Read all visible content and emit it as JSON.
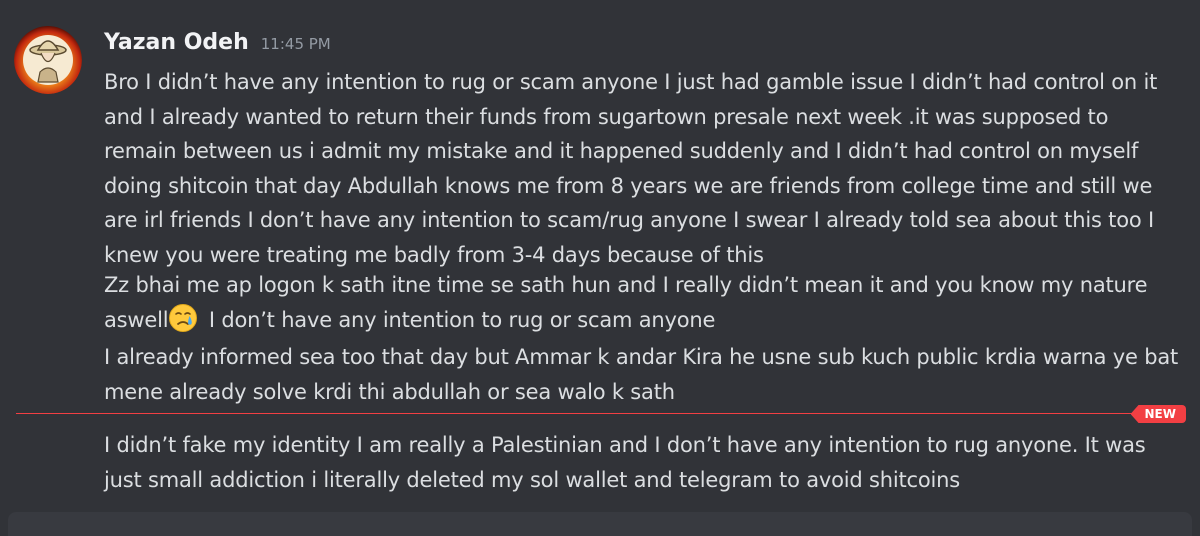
{
  "message": {
    "author": "Yazan Odeh",
    "timestamp": "11:45 PM",
    "avatar_icon": "user-avatar-icon",
    "paragraphs": [
      "Bro I didn’t have any intention to rug or scam anyone I just had gamble issue I didn’t had control on it and I already wanted to return their funds from sugartown presale next week .it was supposed to remain between us i admit my mistake and it happened suddenly and I didn’t had control on myself doing shitcoin that day Abdullah knows me from 8 years we are friends from college time and still we are irl friends I don’t  have any intention to scam/rug anyone I swear I already told sea about this too I knew you were treating me badly from 3-4 days because of  this",
      {
        "before_emoji": "Zz bhai me ap logon k sath itne time se sath hun and I really didn’t mean it and  you know my nature aswell",
        "emoji_icon": "crying-face-emoji-icon",
        "after_emoji": " I don’t have any intention to rug or scam anyone"
      },
      "I already informed sea too that day but Ammar k andar Kira he usne sub kuch public krdia warna ye bat mene already solve krdi thi abdullah or sea walo k sath",
      "I didn’t fake my identity I am really a Palestinian and I don’t have any intention to rug anyone. It was just small addiction i literally deleted my sol wallet and telegram to avoid shitcoins"
    ]
  },
  "divider": {
    "label": "NEW"
  },
  "colors": {
    "background": "#313338",
    "text": "#dbdee1",
    "username": "#f2f3f5",
    "timestamp": "#949ba4",
    "new_accent": "#f23f43",
    "composer": "#383a40"
  }
}
